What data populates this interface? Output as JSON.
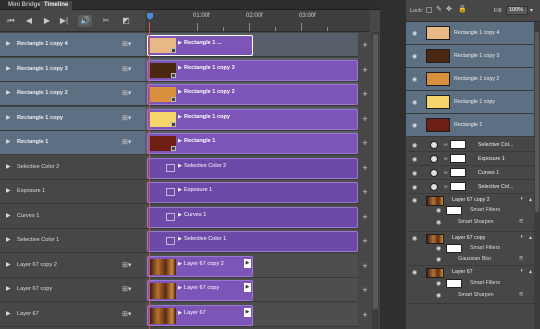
{
  "tabs": {
    "mini_bridge": "Mini Bridge",
    "timeline": "Timeline"
  },
  "toolbar": {
    "first_frame": "⏮",
    "prev_frame": "◀",
    "play": "▶",
    "next_frame": "▶|",
    "audio": "🔊",
    "split": "✂",
    "transition": "◩"
  },
  "ruler": {
    "marks": [
      "01:00f",
      "02:00f",
      "03:00f"
    ]
  },
  "rows": [
    {
      "label": "Rectangle 1 copy 4",
      "clip": "Rectangle 1 ...",
      "color": "#e8b886",
      "selected": true,
      "active": true
    },
    {
      "label": "Rectangle 1 copy 3",
      "clip": "Rectangle 1 copy 3",
      "color": "#4a2812",
      "selected": true
    },
    {
      "label": "Rectangle 1 copy 2",
      "clip": "Rectangle 1 copy 2",
      "color": "#d8903e",
      "selected": true
    },
    {
      "label": "Rectangle 1 copy",
      "clip": "Rectangle 1 copy",
      "color": "#f4d56c",
      "selected": true
    },
    {
      "label": "Rectangle 1",
      "clip": "Rectangle 1",
      "color": "#6e1f13",
      "selected": true
    },
    {
      "label": "Selective Color 2",
      "clip": "Selective Color 2",
      "selected": false
    },
    {
      "label": "Exposure 1",
      "clip": "Exposure 1",
      "selected": false
    },
    {
      "label": "Curves 1",
      "clip": "Curves 1",
      "selected": false
    },
    {
      "label": "Selective Color 1",
      "clip": "Selective Color 1",
      "selected": false
    },
    {
      "label": "Layer 67 copy 2",
      "clip": "Layer 67 copy 2",
      "selected": false
    },
    {
      "label": "Layer 67 copy",
      "clip": "Layer 67 copy",
      "selected": false
    },
    {
      "label": "Layer 67",
      "clip": "Layer 67",
      "selected": false
    }
  ],
  "layers_header": {
    "lock_label": "Lock:",
    "fill_label": "Fill:",
    "fill_value": "100%"
  },
  "layers": [
    {
      "name": "Rectangle 1 copy 4",
      "color": "#e8b886"
    },
    {
      "name": "Rectangle 1 copy 3",
      "color": "#4a2812"
    },
    {
      "name": "Rectangle 1 copy 2",
      "color": "#d8903e"
    },
    {
      "name": "Rectangle 1 copy",
      "color": "#f4d56c"
    },
    {
      "name": "Rectangle 1",
      "color": "#6e1f13"
    }
  ],
  "adjustments": [
    "Selective Col...",
    "Exposure 1",
    "Curves 1",
    "Selective Col..."
  ],
  "smart_layers": [
    {
      "name": "Layer 67 copy 2",
      "smart_filters": "Smart Filters",
      "filter": "Smart Sharpen"
    },
    {
      "name": "Layer 67 copy",
      "smart_filters": "Smart Filters",
      "filter": "Gaussian Blur"
    },
    {
      "name": "Layer 67",
      "smart_filters": "Smart Filters",
      "filter": "Smart Sharpen"
    }
  ],
  "colors": {
    "accent_purple": "#7d55b8",
    "selection_blue": "#5d6f82",
    "playhead_red": "#d9534f"
  }
}
